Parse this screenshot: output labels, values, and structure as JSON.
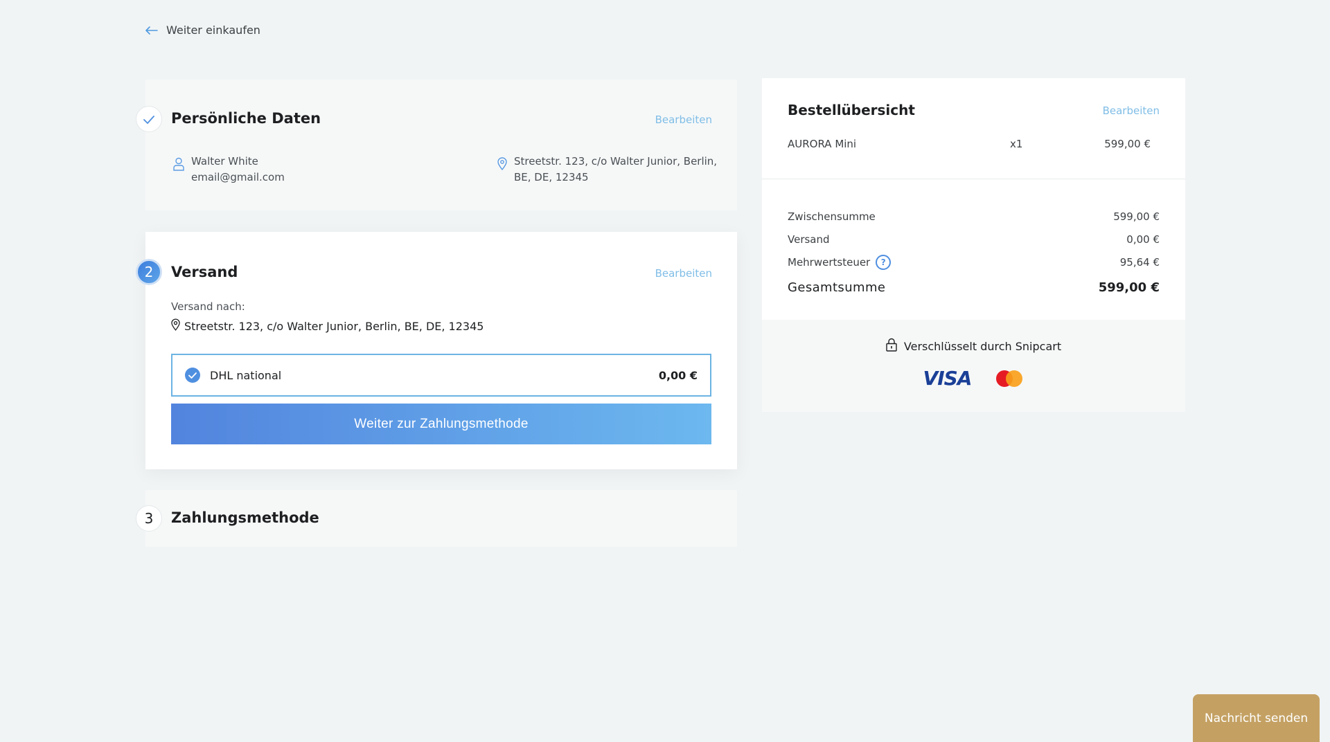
{
  "nav": {
    "back_label": "Weiter einkaufen"
  },
  "personal": {
    "title": "Persönliche Daten",
    "edit_label": "Bearbeiten",
    "name": "Walter White",
    "email": "email@gmail.com",
    "address_line1": "Streetstr. 123, c/o Walter Junior, Berlin,",
    "address_line2": "BE, DE, 12345"
  },
  "shipping": {
    "step_number": "2",
    "title": "Versand",
    "edit_label": "Bearbeiten",
    "ship_to_label": "Versand nach:",
    "ship_to_address": "Streetstr. 123, c/o Walter Junior, Berlin, BE, DE, 12345",
    "method_name": "DHL national",
    "method_price": "0,00 €",
    "continue_label": "Weiter zur Zahlungsmethode"
  },
  "payment": {
    "step_number": "3",
    "title": "Zahlungsmethode"
  },
  "summary": {
    "title": "Bestellübersicht",
    "edit_label": "Bearbeiten",
    "item": {
      "name": "AURORA Mini",
      "qty": "x1",
      "price": "599,00 €"
    },
    "subtotal_label": "Zwischensumme",
    "subtotal_value": "599,00 €",
    "shipping_label": "Versand",
    "shipping_value": "0,00 €",
    "tax_label": "Mehrwertsteuer",
    "tax_value": "95,64 €",
    "total_label": "Gesamtsumme",
    "total_value": "599,00 €",
    "secure_label": "Verschlüsselt durch Snipcart",
    "visa_label": "VISA"
  },
  "chat": {
    "label": "Nachricht senden"
  },
  "icons": {
    "back": "arrow-left-icon",
    "step_done": "checkmark-icon",
    "user": "user-icon",
    "location": "location-pin-icon",
    "selected": "check-circle-icon",
    "help": "help-icon",
    "lock": "lock-icon",
    "visa": "visa-logo",
    "mastercard": "mastercard-logo"
  },
  "colors": {
    "accent": "#4f8fe0",
    "link": "#7fbde6",
    "button_gradient_start": "#5284de",
    "button_gradient_end": "#6cb8ef",
    "chat_button": "#c4a163",
    "background": "#f1f4f5"
  }
}
